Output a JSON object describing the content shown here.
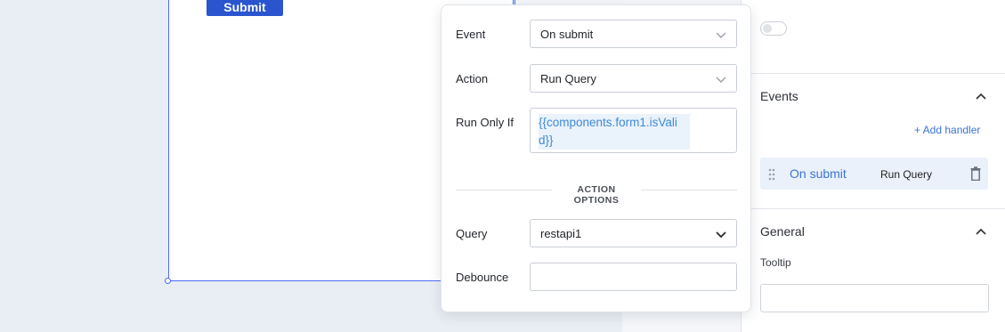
{
  "canvas": {
    "submit_label": "Submit"
  },
  "inspector": {
    "events_title": "Events",
    "add_handler": "+ Add handler",
    "handler": {
      "event": "On submit",
      "action": "Run Query"
    },
    "general_title": "General",
    "tooltip_label": "Tooltip",
    "tooltip_value": ""
  },
  "popover": {
    "event_label": "Event",
    "event_value": "On submit",
    "action_label": "Action",
    "action_value": "Run Query",
    "run_only_if_label": "Run Only If",
    "run_only_if_value": "{{components.form1.isValid}}",
    "action_options_title": "ACTION OPTIONS",
    "query_label": "Query",
    "query_value": "restapi1",
    "debounce_label": "Debounce",
    "debounce_value": ""
  },
  "icons": {
    "dropdown": "chevron-down-icon",
    "collapse": "chevron-up-icon",
    "drag": "drag-handle-icon",
    "delete": "trash-icon"
  },
  "colors": {
    "accent": "#3e73d4",
    "submit_button": "#2a55cf",
    "selection_border": "#4a6ef5",
    "code_text": "#3e8ad8"
  }
}
